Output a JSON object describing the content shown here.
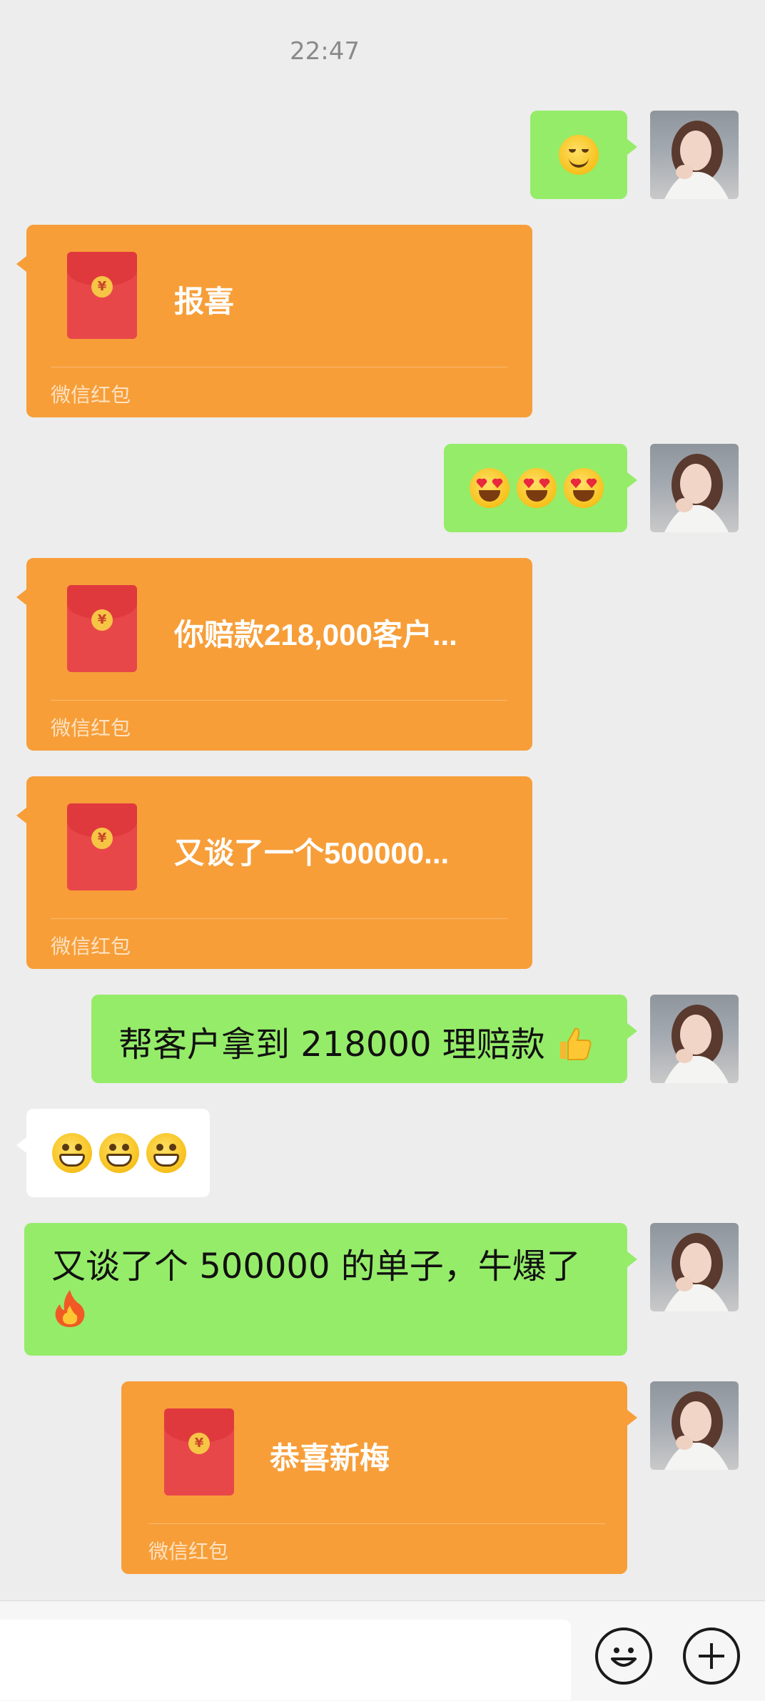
{
  "status": {
    "time": "22:47"
  },
  "messages": [
    {
      "side": "right",
      "type": "emoji",
      "emojis": [
        "smiling-face"
      ]
    },
    {
      "side": "left",
      "type": "red_packet",
      "title": "报喜",
      "footer": "微信红包"
    },
    {
      "side": "right",
      "type": "emoji",
      "emojis": [
        "heart-eyes-face",
        "heart-eyes-face",
        "heart-eyes-face"
      ]
    },
    {
      "side": "left",
      "type": "red_packet",
      "title": "你赔款218,000客户...",
      "footer": "微信红包"
    },
    {
      "side": "left",
      "type": "red_packet",
      "title": "又谈了一个500000...",
      "footer": "微信红包"
    },
    {
      "side": "right",
      "type": "text",
      "text": "帮客户拿到 218000 理赔款",
      "trailing_emoji": "thumbs-up"
    },
    {
      "side": "left",
      "type": "emoji",
      "emojis": [
        "grinning-face",
        "grinning-face",
        "grinning-face"
      ]
    },
    {
      "side": "right",
      "type": "text",
      "text": "又谈了个 500000 的单子，牛爆了",
      "trailing_emoji": "fire"
    },
    {
      "side": "right",
      "type": "red_packet",
      "title": "恭喜新梅",
      "footer": "微信红包"
    }
  ],
  "input_bar": {
    "emoji_button": "emoji-face-icon",
    "more_button": "plus-circle-icon"
  },
  "colors": {
    "background": "#ededed",
    "green_bubble": "#95ec69",
    "red_packet": "#f79e39"
  }
}
